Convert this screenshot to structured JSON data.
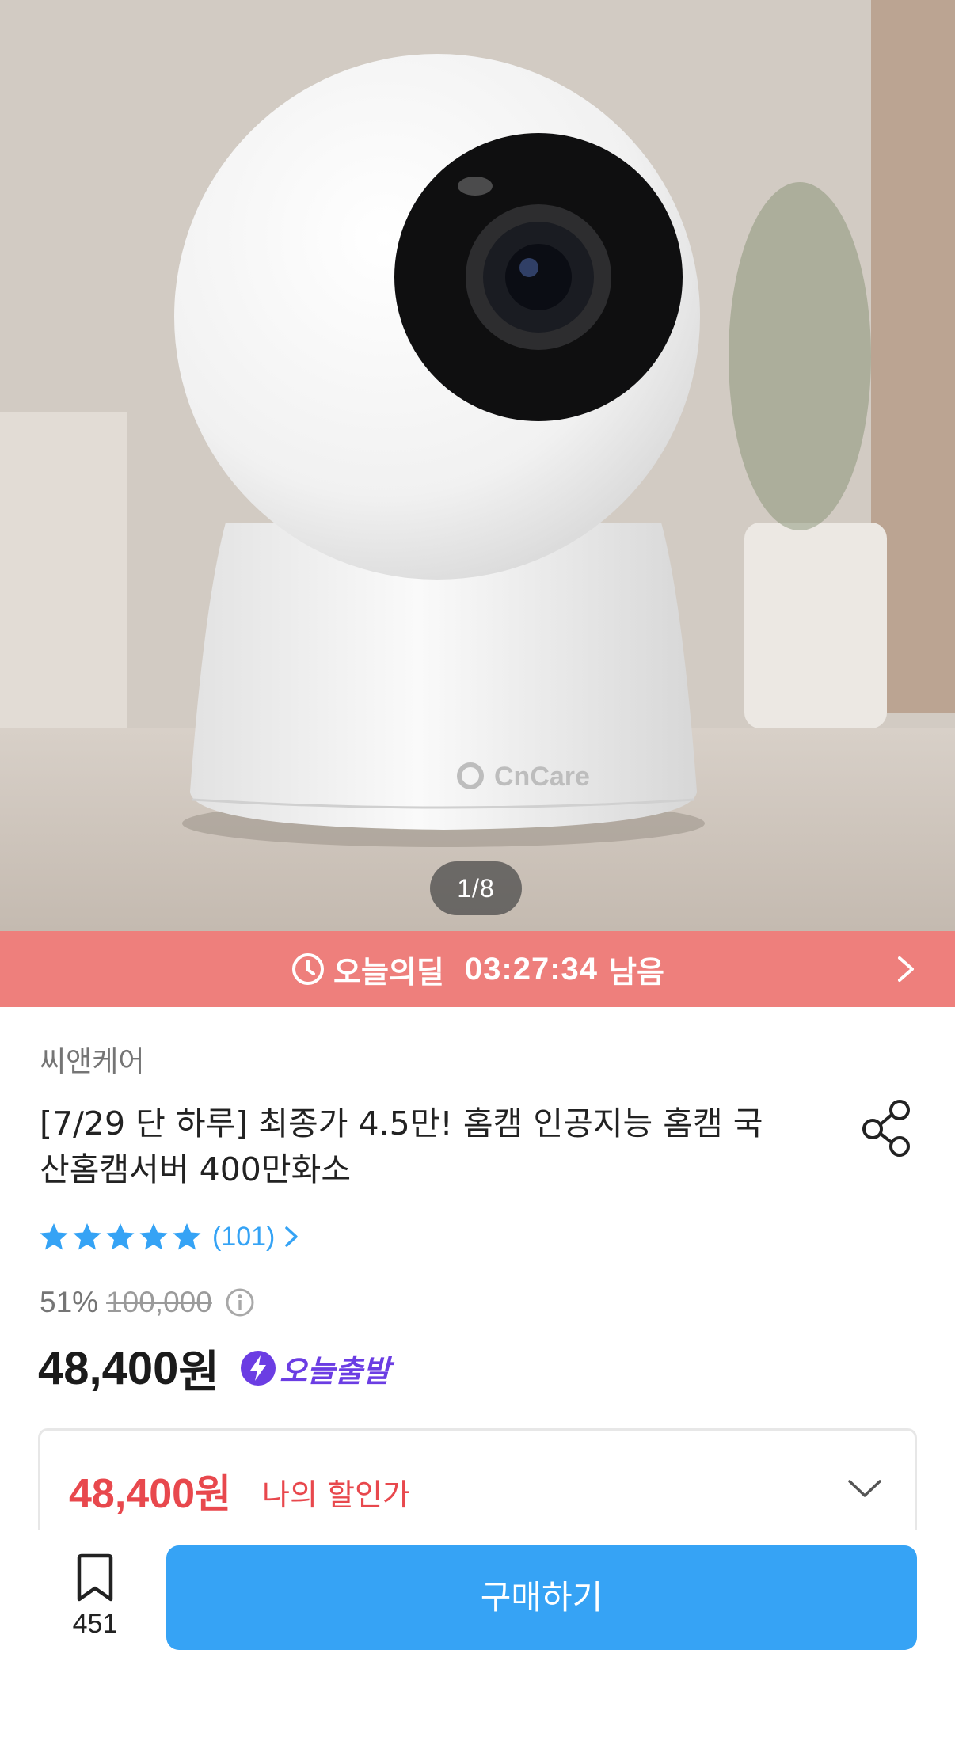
{
  "gallery": {
    "counter": "1/8",
    "brand_mark": "CnCare"
  },
  "deal_banner": {
    "label": "오늘의딜",
    "timer": "03:27:34",
    "remain": "남음",
    "color": "#ee7f7c"
  },
  "product": {
    "brand": "씨앤케어",
    "title": "[7/29 단 하루] 최종가 4.5만! 홈캠  인공지능 홈캠 국산홈캠서버 400만화소",
    "rating": {
      "stars": 5,
      "count": "(101)"
    },
    "discount": "51%",
    "original_price": "100,000",
    "price": "48,400",
    "price_unit": "원",
    "delivery_badge": "오늘출발"
  },
  "my_price": {
    "amount": "48,400",
    "unit": "원",
    "label": "나의 할인가"
  },
  "bottom_bar": {
    "scrap_count": "451",
    "buy_label": "구매하기",
    "accent": "#36a3f5"
  }
}
